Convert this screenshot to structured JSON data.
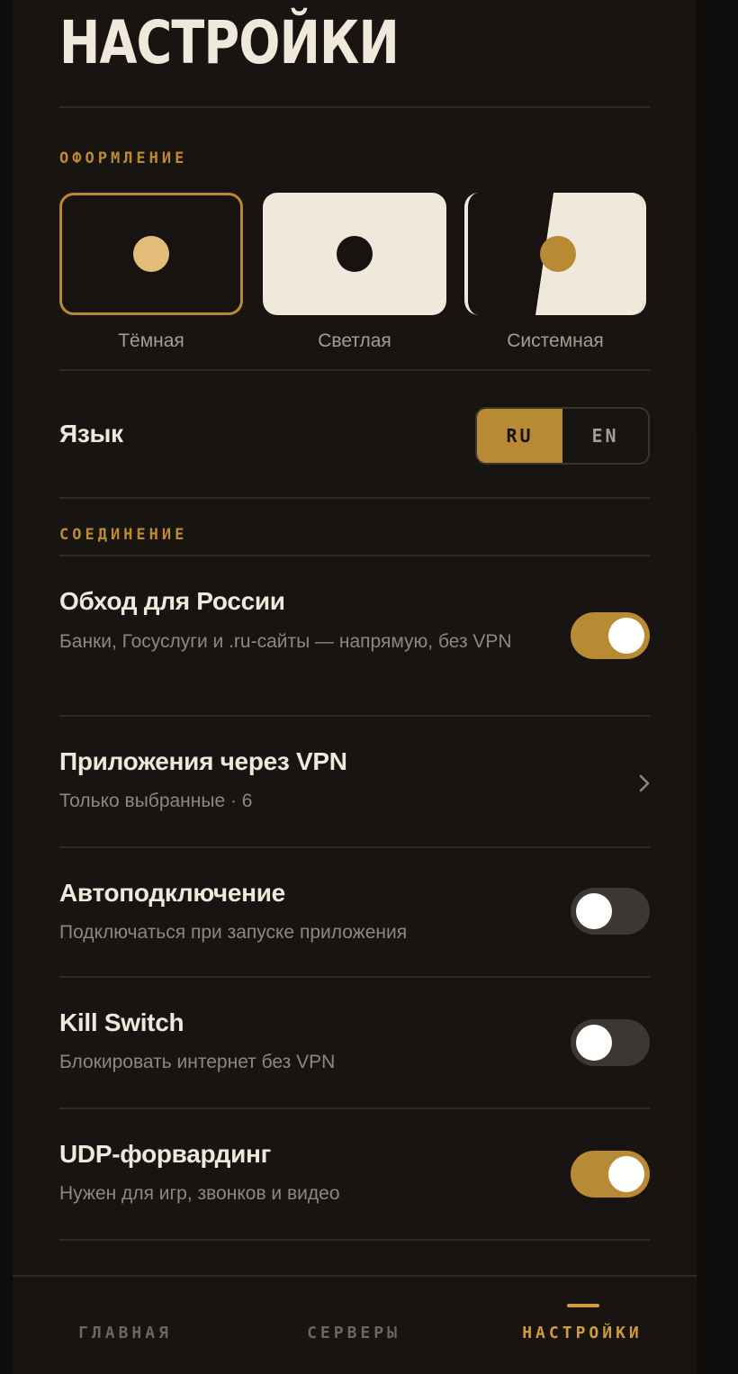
{
  "page_title": "НАСТРОЙКИ",
  "appearance": {
    "header": "ОФОРМЛЕНИЕ",
    "themes": [
      {
        "label": "Тёмная",
        "selected": true
      },
      {
        "label": "Светлая",
        "selected": false
      },
      {
        "label": "Системная",
        "selected": false
      }
    ]
  },
  "language": {
    "label": "Язык",
    "options": [
      "RU",
      "EN"
    ],
    "selected": "RU"
  },
  "connection": {
    "header": "СОЕДИНЕНИЕ",
    "items": [
      {
        "title": "Обход для России",
        "subtitle": "Банки, Госуслуги и .ru-сайты — напрямую, без VPN",
        "control": "toggle",
        "enabled": true
      },
      {
        "title": "Приложения через VPN",
        "subtitle": "Только выбранные · 6",
        "control": "chevron"
      },
      {
        "title": "Автоподключение",
        "subtitle": "Подключаться при запуске приложения",
        "control": "toggle",
        "enabled": false
      },
      {
        "title": "Kill Switch",
        "subtitle": "Блокировать интернет без VPN",
        "control": "toggle",
        "enabled": false
      },
      {
        "title": "UDP-форвардинг",
        "subtitle": "Нужен для игр, звонков и видео",
        "control": "toggle",
        "enabled": true
      }
    ]
  },
  "bottom_nav": {
    "items": [
      {
        "label": "ГЛАВНАЯ",
        "active": false
      },
      {
        "label": "СЕРВЕРЫ",
        "active": false
      },
      {
        "label": "НАСТРОЙКИ",
        "active": true
      }
    ]
  },
  "colors": {
    "background": "#181411",
    "accent": "#b98a34",
    "text_primary": "#f0e8da",
    "text_secondary": "#8f877c",
    "toggle_off": "#3c3733"
  },
  "icons": {
    "chevron": "chevron-right-icon"
  }
}
